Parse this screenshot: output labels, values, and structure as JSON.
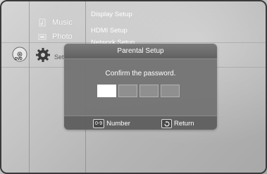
{
  "main_menu": {
    "items": [
      {
        "label": "Music",
        "icon": "music-icon"
      },
      {
        "label": "Photo",
        "icon": "photo-icon"
      },
      {
        "label": "Set",
        "icon": "gear-icon"
      }
    ],
    "disc_label": "DVD"
  },
  "setup_submenu": {
    "items": [
      "Display Setup",
      "HDMI Setup",
      "Network Setup"
    ]
  },
  "dialog": {
    "title": "Parental Setup",
    "message": "Confirm the password.",
    "password_digits_total": 4,
    "password_digits_entered": 0
  },
  "footer": {
    "number_key": "0-9",
    "number_label": "Number",
    "return_icon": "return-icon",
    "return_label": "Return"
  },
  "colors": {
    "dialog_bg": "#767676",
    "active_box": "#ffffff",
    "inactive_box": "#8f8f8f"
  }
}
